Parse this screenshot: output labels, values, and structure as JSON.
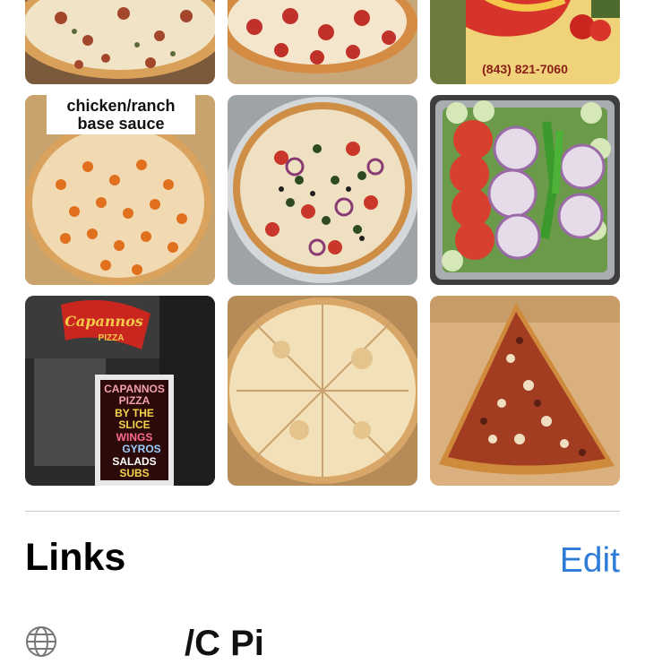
{
  "photos": [
    {
      "name": "pizza-photo-1",
      "caption": ""
    },
    {
      "name": "pizza-photo-2",
      "caption": ""
    },
    {
      "name": "menu-card-photo",
      "caption": "(843) 821-7060"
    },
    {
      "name": "chicken-ranch-pizza-photo",
      "caption_line1": "chicken/ranch",
      "caption_line2": "base sauce"
    },
    {
      "name": "veggie-pizza-photo",
      "caption": ""
    },
    {
      "name": "salad-tray-photo",
      "caption": ""
    },
    {
      "name": "storefront-photo",
      "sign": "Capannos",
      "sign_sub": "PIZZA",
      "board": [
        "CAPANNOS",
        "PIZZA",
        "BY THE",
        "SLICE",
        "WINGS",
        "GYROS",
        "SALADS",
        "SUBS"
      ]
    },
    {
      "name": "cheese-pizza-photo",
      "caption": ""
    },
    {
      "name": "meat-slice-photo",
      "caption": ""
    }
  ],
  "links_section": {
    "title": "Links",
    "edit_label": "Edit",
    "link_text": "/C          Pi"
  },
  "colors": {
    "accent": "#2f7bd8",
    "divider": "#c8c8cc"
  }
}
